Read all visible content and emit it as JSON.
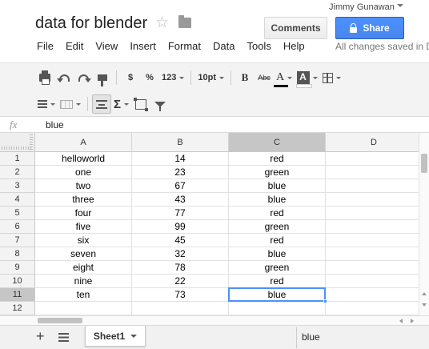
{
  "header": {
    "doc_title": "data for blender",
    "user_name": "Jimmy Gunawan",
    "comments_label": "Comments",
    "share_label": "Share",
    "save_status": "All changes saved in Drive"
  },
  "menu": [
    "File",
    "Edit",
    "View",
    "Insert",
    "Format",
    "Data",
    "Tools",
    "Help"
  ],
  "toolbar": {
    "currency": "$",
    "percent": "%",
    "number_format": "123",
    "font_size": "10pt",
    "bold": "B",
    "strike": "Abc",
    "text_color": "A",
    "sigma": "Σ"
  },
  "formula_bar": {
    "fx": "fx",
    "value": "blue"
  },
  "columns": [
    "A",
    "B",
    "C",
    "D"
  ],
  "rows": [
    {
      "num": "1",
      "a": "helloworld",
      "b": "14",
      "c": "red"
    },
    {
      "num": "2",
      "a": "one",
      "b": "23",
      "c": "green"
    },
    {
      "num": "3",
      "a": "two",
      "b": "67",
      "c": "blue"
    },
    {
      "num": "4",
      "a": "three",
      "b": "43",
      "c": "blue"
    },
    {
      "num": "5",
      "a": "four",
      "b": "77",
      "c": "red"
    },
    {
      "num": "6",
      "a": "five",
      "b": "99",
      "c": "green"
    },
    {
      "num": "7",
      "a": "six",
      "b": "45",
      "c": "red"
    },
    {
      "num": "8",
      "a": "seven",
      "b": "32",
      "c": "blue"
    },
    {
      "num": "9",
      "a": "eight",
      "b": "78",
      "c": "green"
    },
    {
      "num": "10",
      "a": "nine",
      "b": "22",
      "c": "red"
    },
    {
      "num": "11",
      "a": "ten",
      "b": "73",
      "c": "blue"
    },
    {
      "num": "12",
      "a": "",
      "b": "",
      "c": ""
    }
  ],
  "selection": {
    "cell": "C11",
    "active_column": "C",
    "active_row": "11"
  },
  "sheet_tabs": {
    "active": "Sheet1"
  },
  "summary": "blue",
  "colors": {
    "accent": "#4d90fe",
    "share": "#4787ed"
  }
}
